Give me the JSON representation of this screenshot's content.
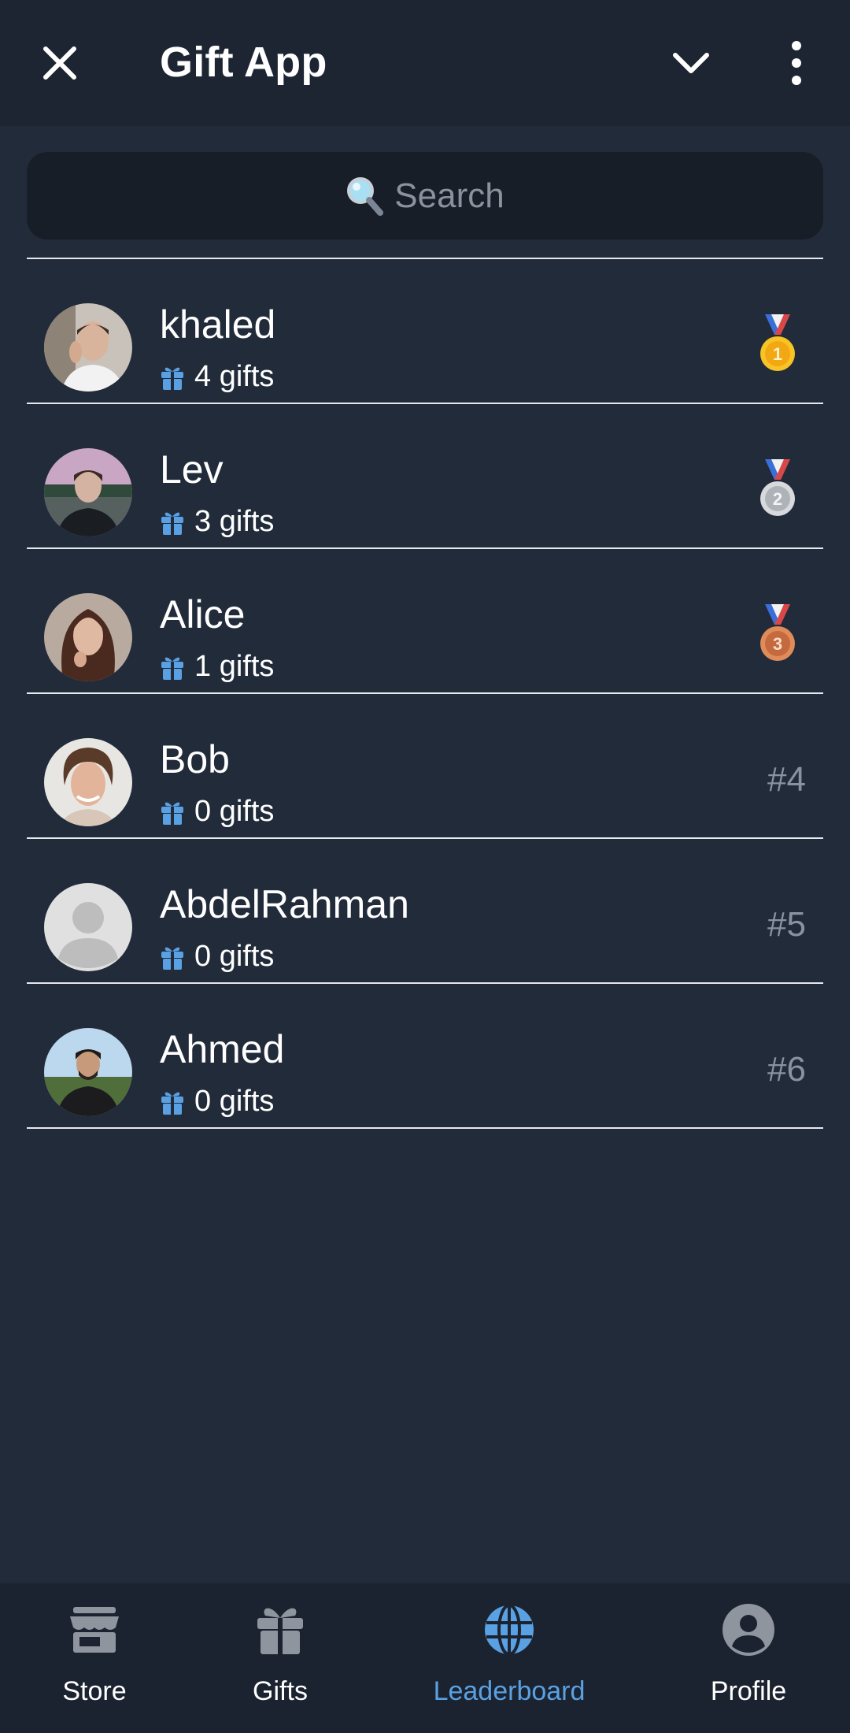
{
  "header": {
    "title": "Gift App",
    "close_icon": "close-icon",
    "collapse_icon": "chevron-down-icon",
    "more_icon": "more-vertical-icon"
  },
  "search": {
    "placeholder": "Search",
    "icon": "magnifying-glass-icon"
  },
  "leaderboard": [
    {
      "name": "khaled",
      "gifts": "4 gifts",
      "rank_type": "medal",
      "medal": "gold",
      "medal_number": "1"
    },
    {
      "name": "Lev",
      "gifts": "3 gifts",
      "rank_type": "medal",
      "medal": "silver",
      "medal_number": "2"
    },
    {
      "name": "Alice",
      "gifts": "1 gifts",
      "rank_type": "medal",
      "medal": "bronze",
      "medal_number": "3"
    },
    {
      "name": "Bob",
      "gifts": "0 gifts",
      "rank_type": "text",
      "rank": "#4"
    },
    {
      "name": "AbdelRahman",
      "gifts": "0 gifts",
      "rank_type": "text",
      "rank": "#5"
    },
    {
      "name": "Ahmed",
      "gifts": "0 gifts",
      "rank_type": "text",
      "rank": "#6"
    }
  ],
  "bottom_nav": {
    "items": [
      {
        "label": "Store",
        "icon": "store-icon",
        "active": false
      },
      {
        "label": "Gifts",
        "icon": "gift-icon",
        "active": false
      },
      {
        "label": "Leaderboard",
        "icon": "globe-icon",
        "active": true
      },
      {
        "label": "Profile",
        "icon": "profile-icon",
        "active": false
      }
    ]
  },
  "colors": {
    "background": "#222b3a",
    "header": "#1d2532",
    "accent": "#5aa1e3",
    "muted": "#8a929f"
  }
}
